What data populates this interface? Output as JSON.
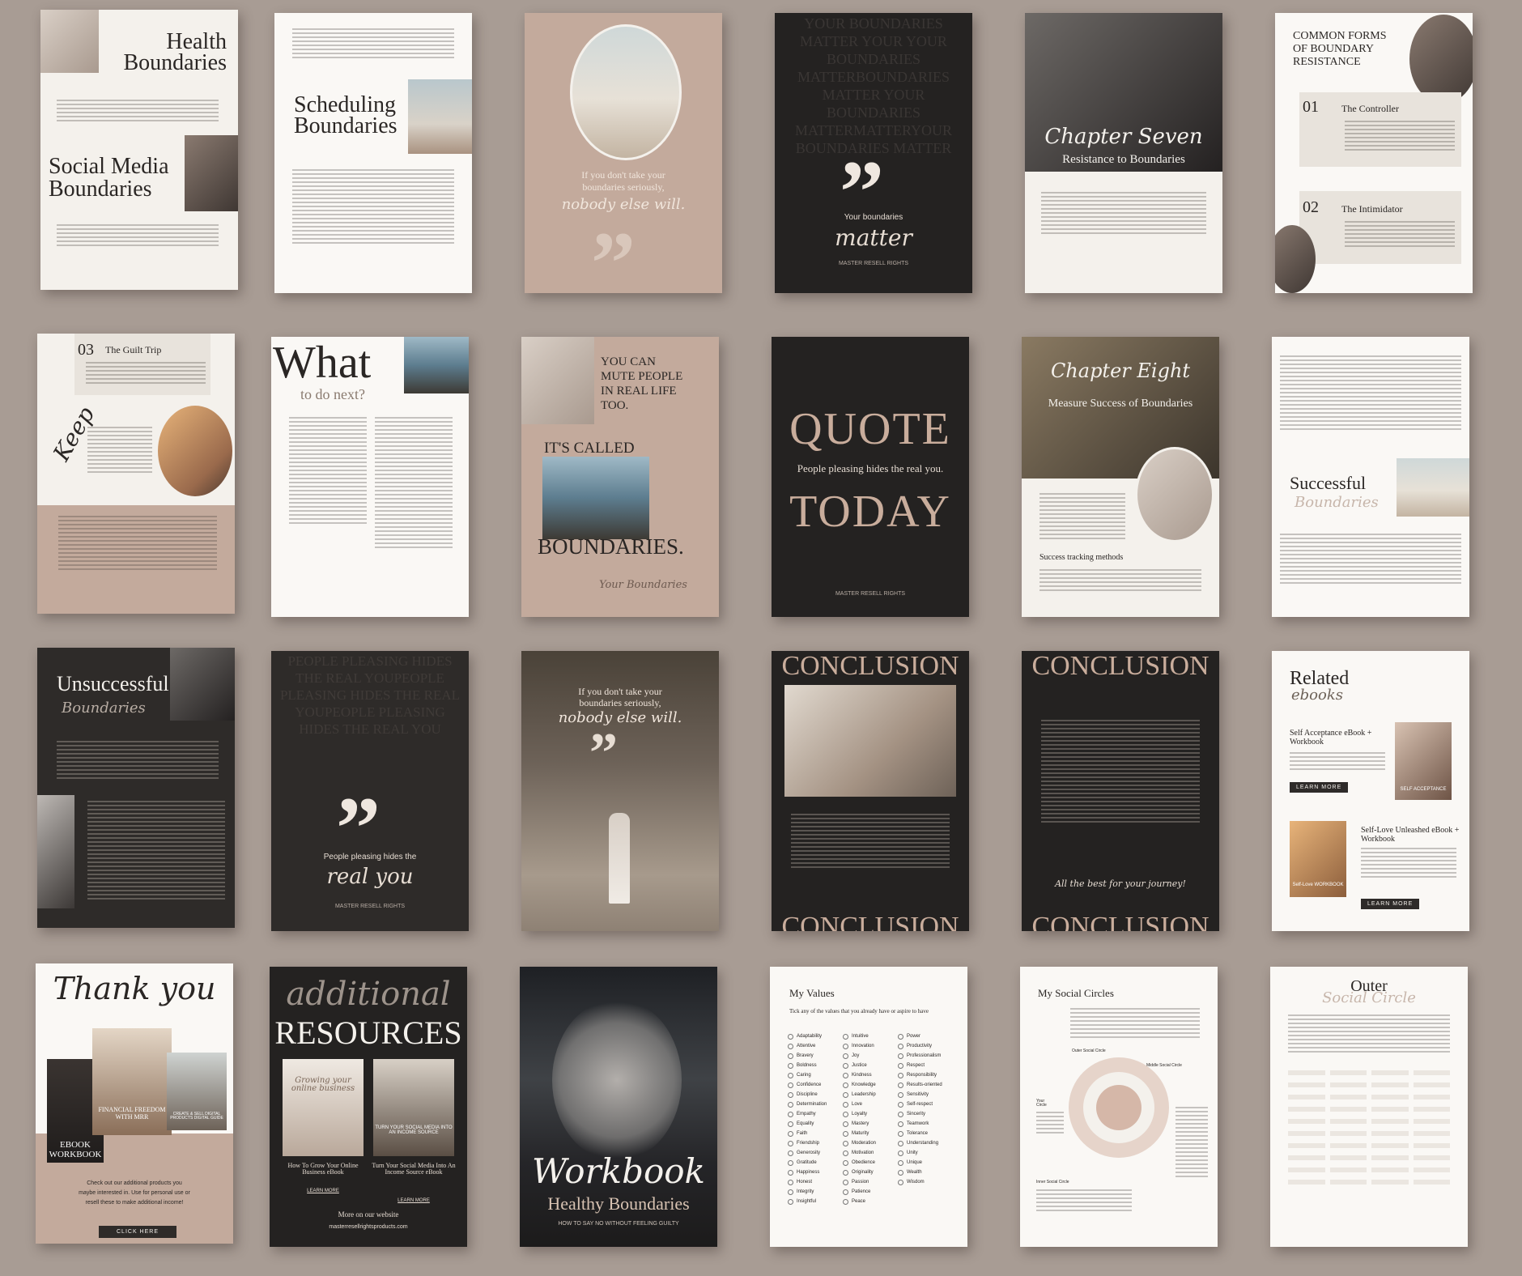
{
  "pages": {
    "health": {
      "title_1": "Health",
      "title_2": "Boundaries",
      "title_3": "Social Media",
      "title_4": "Boundaries"
    },
    "scheduling": {
      "title_1": "Scheduling",
      "title_2": "Boundaries"
    },
    "quote1": {
      "line1": "If you don't take your",
      "line2": "boundaries seriously,",
      "script": "nobody else will."
    },
    "matter": {
      "bg_text": "YOUR BOUNDARIES MATTER YOUR YOUR BOUNDARIES MATTERBOUNDARIES MATTER YOUR BOUNDARIES MATTERMATTERYOUR BOUNDARIES MATTER",
      "line": "Your boundaries",
      "script": "matter",
      "footer": "MASTER RESELL RIGHTS"
    },
    "chapter7": {
      "script": "Chapter Seven",
      "subtitle": "Resistance to Boundaries"
    },
    "common": {
      "title_1": "COMMON FORMS",
      "title_2": "OF BOUNDARY",
      "title_3": "RESISTANCE",
      "n1": "01",
      "t1": "The Controller",
      "n2": "02",
      "t2": "The Intimidator"
    },
    "guilt": {
      "n": "03",
      "t": "The Guilt Trip",
      "script": "Keep"
    },
    "whatnext": {
      "title": "What",
      "subtitle": "to do next?"
    },
    "mute": {
      "l1": "YOU CAN",
      "l2": "MUTE PEOPLE",
      "l3": "IN REAL LIFE",
      "l4": "TOO.",
      "called": "IT'S CALLED",
      "boundaries": "BOUNDARIES.",
      "script": "Your Boundaries"
    },
    "quote_today": {
      "q": "QUOTE",
      "line": "People pleasing hides the real you.",
      "today": "TODAY",
      "footer": "MASTER RESELL RIGHTS"
    },
    "chapter8": {
      "script": "Chapter Eight",
      "subtitle": "Measure Success of Boundaries",
      "section": "Success tracking methods"
    },
    "successful": {
      "title": "Successful",
      "script": "Boundaries"
    },
    "unsuccessful": {
      "title": "Unsuccessful",
      "script": "Boundaries"
    },
    "realyou": {
      "bg_text": "PEOPLE PLEASING HIDES THE REAL YOUPEOPLE PLEASING HIDES THE REAL YOUPEOPLE PLEASING HIDES THE REAL YOU",
      "line": "People pleasing hides the",
      "script": "real you",
      "footer": "MASTER RESELL RIGHTS"
    },
    "quote2": {
      "line1": "If you don't take your",
      "line2": "boundaries seriously,",
      "script": "nobody else will."
    },
    "conclusion1": {
      "title": "CONCLUSION",
      "bottom": "CONCLUSION"
    },
    "conclusion2": {
      "title": "CONCLUSION",
      "script": "All the best for your journey!",
      "bottom": "CONCLUSION"
    },
    "related": {
      "title": "Related",
      "script": "ebooks",
      "b1_title": "Self Acceptance eBook + Workbook",
      "b1_btn": "LEARN MORE",
      "b2_title": "Self-Love Unleashed eBook + Workbook",
      "b2_btn": "LEARN MORE",
      "cover1": "SELF ACCEPTANCE",
      "cover2": "Self-Love WORKBOOK"
    },
    "thankyou": {
      "script": "Thank you",
      "cover_a": "EBOOK WORKBOOK",
      "cover_b": "FINANCIAL FREEDOM WITH MRR",
      "cover_c": "CREATE & SELL DIGITAL PRODUCTS DIGITAL GUIDE",
      "line1": "Check out our additional products you",
      "line2": "maybe interested in. Use for personal use or",
      "line3": "resell these to make additional income!",
      "btn": "CLICK HERE"
    },
    "resources": {
      "script": "additional",
      "title": "RESOURCES",
      "c1": "Growing your online business",
      "c2": "TURN YOUR SOCIAL MEDIA INTO AN INCOME SOURCE",
      "b1": "How To Grow Your Online Business eBook",
      "b2": "Turn Your Social Media Into An Income Source eBook",
      "l1": "LEARN MORE",
      "l2": "LEARN MORE",
      "more": "More on our website",
      "site": "masterresellrightsproducts.com"
    },
    "workbook": {
      "script": "Workbook",
      "title": "Healthy Boundaries",
      "sub": "HOW TO SAY NO WITHOUT FEELING GUILTY"
    },
    "values": {
      "title": "My Values",
      "instr": "Tick any of the values that you already have or aspire to have",
      "col1": [
        "Adaptability",
        "Attentive",
        "Bravery",
        "Boldness",
        "Caring",
        "Confidence",
        "Discipline",
        "Determination",
        "Empathy",
        "Equality",
        "Faith",
        "Friendship",
        "Generosity",
        "Gratitude",
        "Happiness",
        "Honest",
        "Integrity",
        "Insightful"
      ],
      "col2": [
        "Intuitive",
        "Innovation",
        "Joy",
        "Justice",
        "Kindness",
        "Knowledge",
        "Leadership",
        "Love",
        "Loyalty",
        "Mastery",
        "Maturity",
        "Moderation",
        "Motivation",
        "Obedience",
        "Originality",
        "Passion",
        "Patience",
        "Peace"
      ],
      "col3": [
        "Power",
        "Productivity",
        "Professionalism",
        "Respect",
        "Responsibility",
        "Results-oriented",
        "Sensitivity",
        "Self-respect",
        "Sincerity",
        "Teamwork",
        "Tolerance",
        "Understanding",
        "Unity",
        "Unique",
        "Wealth",
        "Wisdom"
      ]
    },
    "circles": {
      "title": "My Social Circles",
      "outer": "Outer Social Circle",
      "middle": "Middle Social Circle",
      "inner": "Inner Social Circle",
      "you": "Your Circle"
    },
    "outer": {
      "title": "Outer",
      "script": "Social Circle"
    }
  }
}
